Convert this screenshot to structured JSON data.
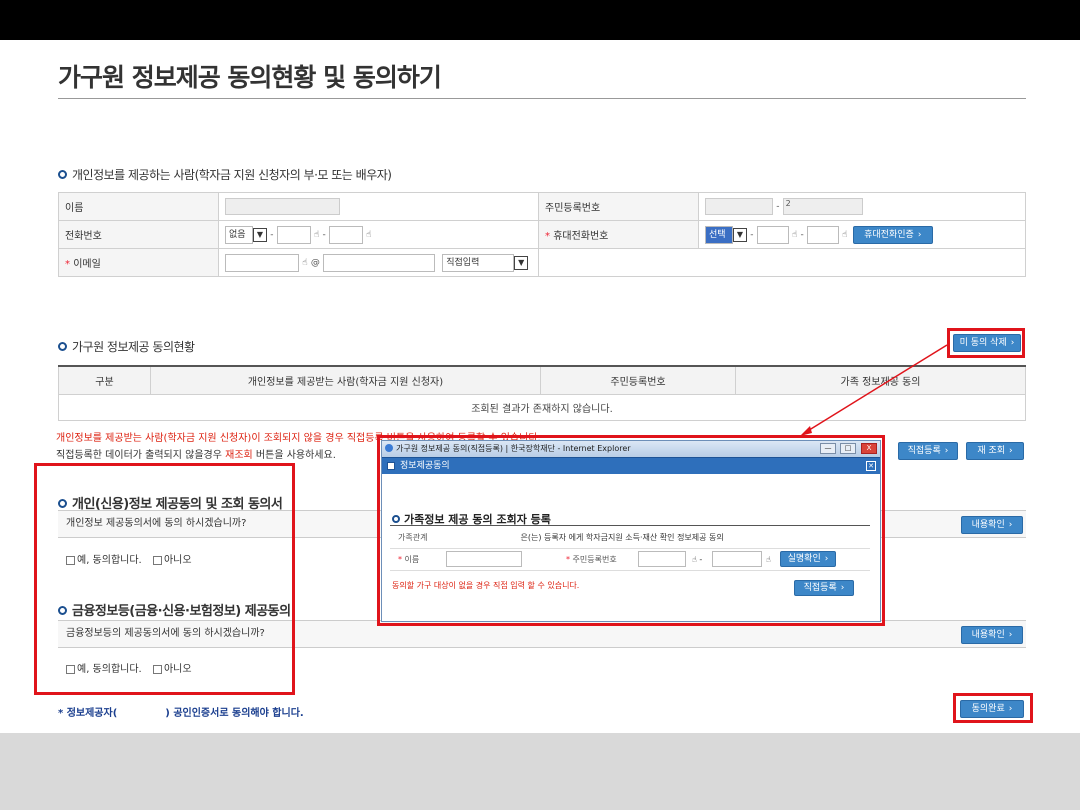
{
  "page": {
    "title": "가구원 정보제공 동의현황 및 동의하기"
  },
  "provider_section": {
    "heading": "개인정보를 제공하는 사람(학자금 지원 신청자의 부·모 또는 배우자)",
    "name_label": "이름",
    "rrn_label": "주민등록번호",
    "rrn_suffix": "2",
    "phone_label": "전화번호",
    "phone_select": "없음",
    "mobile_label": "휴대전화번호",
    "mobile_select": "선택",
    "mobile_verify_btn": "휴대전화인증",
    "email_label": "이메일",
    "email_at": "@",
    "email_domain_select": "직접입력",
    "required_mark": "*",
    "dash": "-"
  },
  "status_section": {
    "heading": "가구원 정보제공 동의현황",
    "delete_btn": "미 동의 삭제",
    "columns": [
      "구분",
      "개인정보를 제공받는 사람(학자금 지원 신청자)",
      "주민등록번호",
      "가족 정보제공 동의"
    ],
    "empty_message": "조회된 결과가 존재하지 않습니다.",
    "notice_red": "개인정보를 제공받는 사람(학자금 지원 신청자)이 조회되지 않을 경우 직접등록 버튼을 사용하여 등록할 수 있습니다.",
    "notice_black_pre": "직접등록한 데이터가 출력되지 않을경우 ",
    "notice_black_red": "재조회",
    "notice_black_post": " 버튼을 사용하세요.",
    "direct_btn": "직접등록",
    "reload_btn": "재 조회"
  },
  "credit_section": {
    "heading": "개인(신용)정보 제공동의 및 조회 동의서",
    "question": "개인정보 제공동의서에 동의 하시겠습니까?",
    "yes": "예, 동의합니다.",
    "no": "아니오",
    "detail_btn": "내용확인"
  },
  "finance_section": {
    "heading": "금융정보등(금융·신용·보험정보) 제공동의",
    "question": "금융정보등의 제공동의서에 동의 하시겠습니까?",
    "yes": "예, 동의합니다.",
    "no": "아니오",
    "detail_btn": "내용확인"
  },
  "footer": {
    "note_pre": "* 정보제공자(",
    "note_post": ") 공인인증서로 동의해야 합니다.",
    "complete_btn": "동의완료"
  },
  "popup": {
    "window_title": "가구원 정보제공 동의(직접등록) | 한국장학재단 - Internet Explorer",
    "inner_title": "정보제공동의",
    "heading": "가족정보 제공 동의 조회자 등록",
    "relation_label": "가족관계",
    "relation_text": "은(는) 등록자 에게 학자금지원 소득·재산 확인 정보제공 동의",
    "name_label": "이름",
    "rrn_label": "주민등록번호",
    "verify_btn": "실명확인",
    "notice": "동의할 가구 대상이 없을 경우 직접 입력 할 수 있습니다.",
    "register_btn": "직접등록",
    "ctrl_min": "—",
    "ctrl_max": "□",
    "ctrl_close": "X"
  },
  "colors": {
    "button_blue": "#3d87c8",
    "highlight_red": "#e0141b",
    "notice_red": "#d21"
  }
}
